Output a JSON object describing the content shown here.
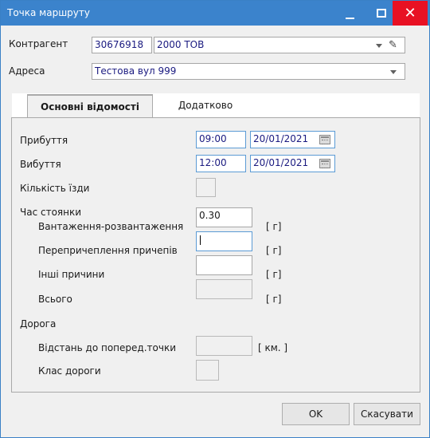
{
  "window": {
    "title": "Точка маршруту"
  },
  "header": {
    "counterparty_label": "Контрагент",
    "counterparty_code": "30676918",
    "counterparty_name": "2000 ТОВ",
    "address_label": "Адреса",
    "address_value": "Тестова вул 999"
  },
  "tabs": [
    {
      "label": "Основні відомості",
      "active": true
    },
    {
      "label": "Додатково",
      "active": false
    }
  ],
  "main": {
    "arrival_label": "Прибуття",
    "arrival_time": "09:00",
    "arrival_date": "20/01/2021",
    "departure_label": "Вибуття",
    "departure_time": "12:00",
    "departure_date": "20/01/2021",
    "trips_label": "Кількість їзди",
    "trips_value": "",
    "parking_label": "Час стоянки",
    "loading_label": "Вантаження-розвантаження",
    "loading_value": "0.30",
    "recoupling_label": "Перепричеплення причепів",
    "recoupling_value": "",
    "other_label": "Інші причини",
    "other_value": "",
    "total_label": "Всього",
    "total_value": "",
    "unit_hours": "[ г]",
    "road_label": "Дорога",
    "distance_label": "Відстань до поперед.точки",
    "distance_value": "",
    "unit_km": "[ км. ]",
    "road_class_label": "Клас дороги",
    "road_class_value": ""
  },
  "footer": {
    "ok_label": "OK",
    "cancel_label": "Скасувати"
  },
  "colors": {
    "titlebar": "#3b83cc",
    "close": "#e81123",
    "value_text": "#1a1a80"
  },
  "icons": [
    "minimize-icon",
    "maximize-icon",
    "close-icon",
    "chevron-down-icon",
    "pencil-icon",
    "calendar-icon"
  ]
}
